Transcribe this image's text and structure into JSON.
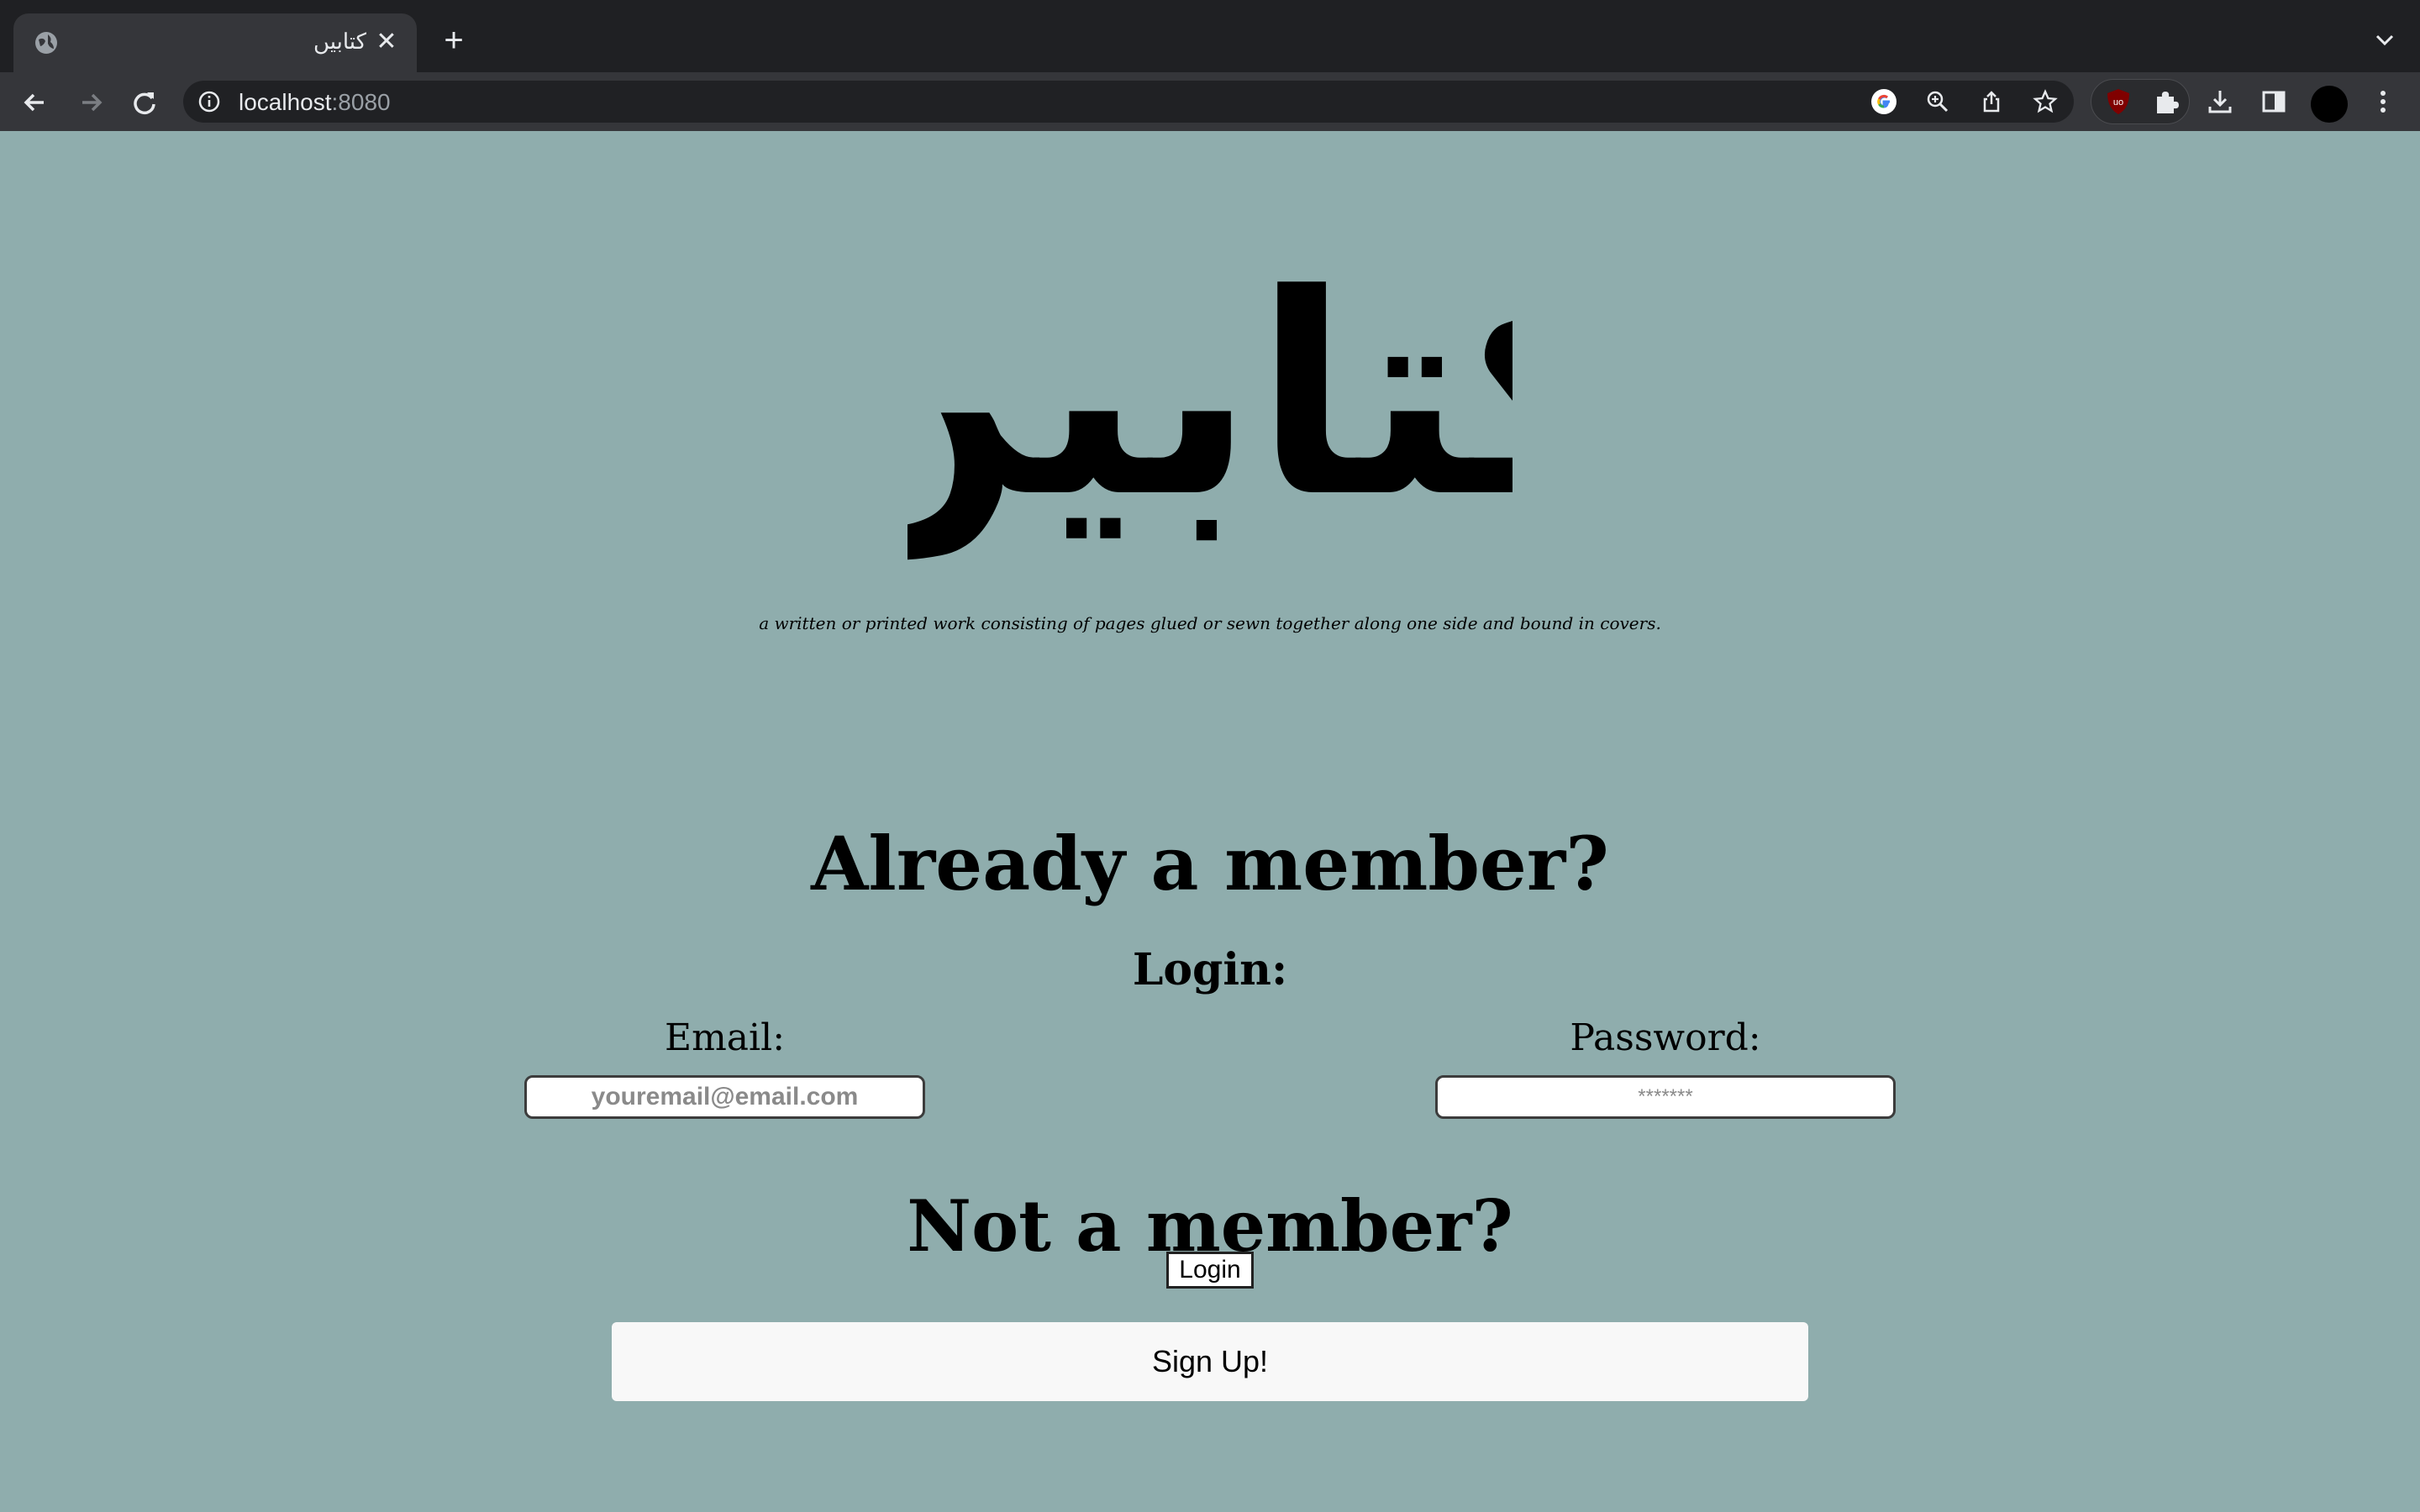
{
  "browser": {
    "tab_title": "کتابیں",
    "url_host": "localhost",
    "url_port": ":8080"
  },
  "page": {
    "logo_text": "کتابیں",
    "tagline": "a written or printed work consisting of pages glued or sewn together along one side and bound in covers.",
    "already_heading": "Already a member?",
    "login_heading": "Login:",
    "email_label": "Email:",
    "email_placeholder": "youremail@email.com",
    "password_label": "Password:",
    "password_placeholder": "*******",
    "login_button": "Login",
    "not_member_heading": "Not a member?",
    "signup_button": "Sign Up!"
  },
  "colors": {
    "page_background": "#8fadad",
    "chrome_dark": "#1f2023",
    "toolbar": "#35363a"
  },
  "icons": [
    "globe-icon",
    "close-icon",
    "plus-icon",
    "chevron-down-icon",
    "back-icon",
    "forward-icon",
    "reload-icon",
    "info-icon",
    "google-icon",
    "zoom-icon",
    "share-icon",
    "star-icon",
    "ublock-icon",
    "puzzle-icon",
    "download-icon",
    "sidepanel-icon",
    "avatar",
    "kebab-menu-icon"
  ]
}
